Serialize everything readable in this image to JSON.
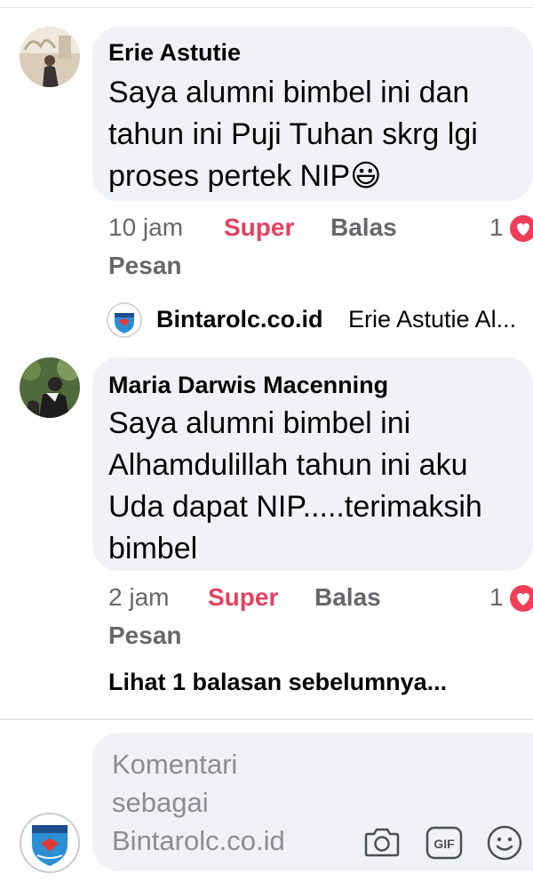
{
  "comments": [
    {
      "author": "Erie Astutie",
      "lines": [
        "Saya alumni bimbel ini dan",
        "tahun ini Puji Tuhan skrg lgi",
        "proses pertek NIP😃"
      ],
      "time": "10 jam",
      "reaction_label": "Super",
      "reply_label": "Balas",
      "message_label": "Pesan",
      "reaction_count": "1",
      "reply_preview": {
        "name": "Bintarolc.co.id",
        "text": "Erie Astutie Al..."
      }
    },
    {
      "author": "Maria Darwis Macenning",
      "lines": [
        "Saya alumni bimbel ini",
        "Alhamdulillah tahun ini aku",
        "Uda dapat NIP.....terimaksih",
        "bimbel"
      ],
      "time": "2 jam",
      "reaction_label": "Super",
      "reply_label": "Balas",
      "message_label": "Pesan",
      "reaction_count": "1"
    }
  ],
  "view_previous_replies": "Lihat 1 balasan sebelumnya...",
  "composer": {
    "placeholder_lines": [
      "Komentari",
      "sebagai",
      "Bintarolc.co.id"
    ],
    "icons": [
      "camera-icon",
      "gif-icon",
      "emoji-icon"
    ]
  },
  "colors": {
    "reaction": "#e4405f",
    "heart": "#f33e58",
    "bubble": "#f0f2f5",
    "secondary_text": "#65676b"
  }
}
